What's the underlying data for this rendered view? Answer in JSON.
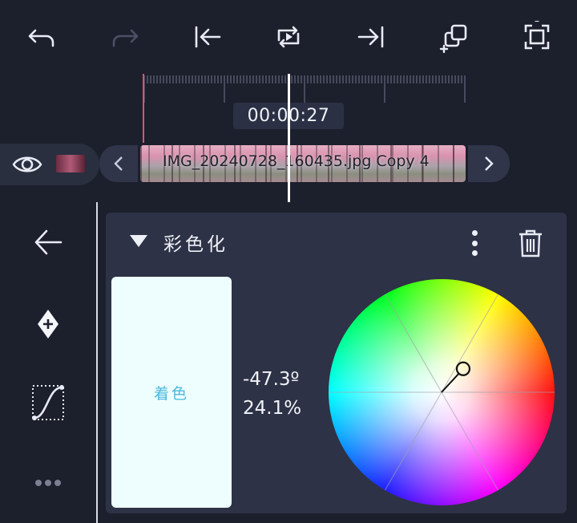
{
  "toolbar": {
    "buttons": [
      {
        "name": "undo-icon",
        "enabled": true
      },
      {
        "name": "redo-icon",
        "enabled": false
      },
      {
        "name": "jump-to-start-icon",
        "enabled": true
      },
      {
        "name": "loop-play-icon",
        "enabled": true
      },
      {
        "name": "jump-to-end-icon",
        "enabled": true
      },
      {
        "name": "duplicate-add-icon",
        "enabled": true
      },
      {
        "name": "fullscreen-icon",
        "enabled": true
      }
    ]
  },
  "timeline": {
    "timecode": "00:00:27",
    "clip_name": "IMG_20240728_160435.jpg Copy 4"
  },
  "sidebar": {
    "items": [
      "back-arrow-icon",
      "add-keyframe-icon",
      "curve-icon",
      "more-horizontal-icon"
    ]
  },
  "effect_panel": {
    "title": "彩色化",
    "swatch_label": "着色",
    "swatch_color": "#eefefe",
    "hue_value": "-47.3º",
    "saturation_value": "24.1%",
    "hue_degrees": -47.3,
    "saturation_percent": 24.1
  },
  "colors": {
    "background": "#1c1f2c",
    "panel": "#2e3246",
    "accent_red": "#d4566a",
    "playhead": "#ffffff"
  }
}
